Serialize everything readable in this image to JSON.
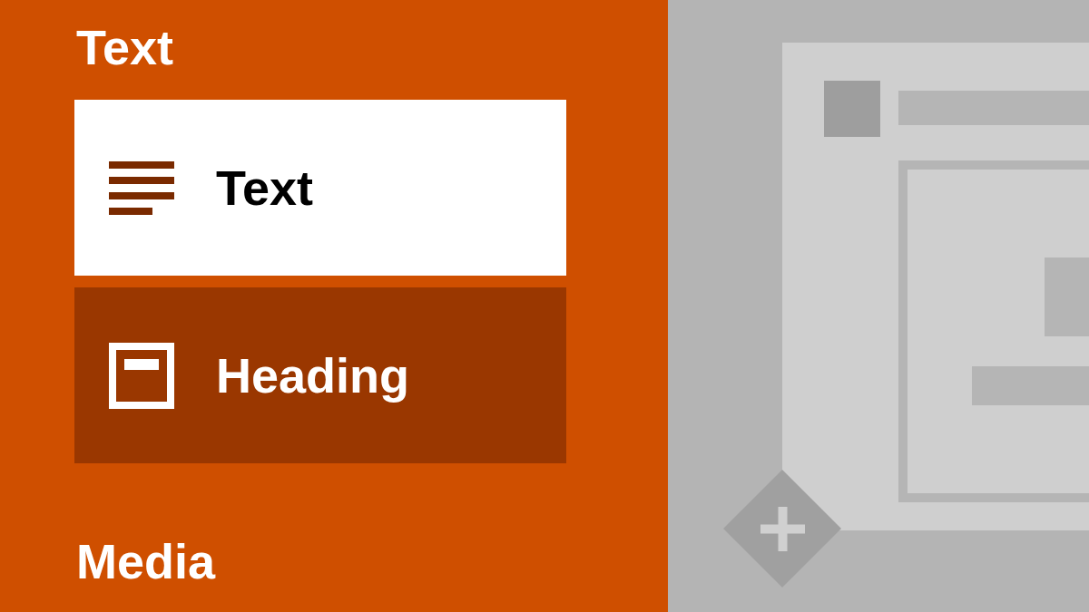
{
  "sections": [
    {
      "title": "Text",
      "items": [
        {
          "label": "Text",
          "kind": "text",
          "selected": true
        },
        {
          "label": "Heading",
          "kind": "heading",
          "selected": false
        }
      ]
    },
    {
      "title": "Media"
    }
  ]
}
